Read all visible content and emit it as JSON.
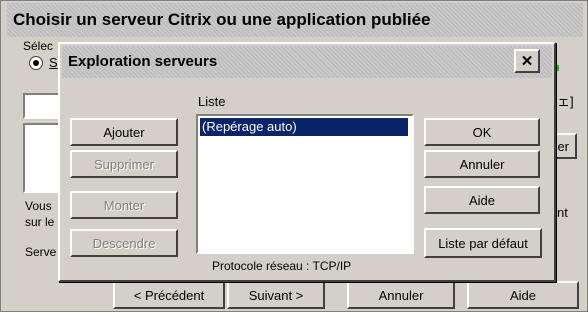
{
  "back_window": {
    "title": "Choisir un serveur Citrix ou une application publiée",
    "fragments": {
      "select_label": "Sélec",
      "radio_label": "S",
      "right_text_1": "ェ]",
      "right_text_2": "er",
      "you_text": "Vous",
      "on_text": "sur le",
      "right_text_3": "nt",
      "server_text": "Serve"
    },
    "buttons": {
      "previous": "< Précédent",
      "next": "Suivant >",
      "cancel": "Annuler",
      "help": "Aide"
    }
  },
  "dialog": {
    "title": "Exploration serveurs",
    "close_glyph": "✕",
    "list_label": "Liste",
    "list_items": [
      "(Repérage auto)"
    ],
    "protocol": "Protocole réseau : TCP/IP",
    "left_buttons": {
      "add": "Ajouter",
      "remove": "Supprimer",
      "up": "Monter",
      "down": "Descendre"
    },
    "right_buttons": {
      "ok": "OK",
      "cancel": "Annuler",
      "help": "Aide",
      "default_list": "Liste par défaut"
    }
  },
  "colors": {
    "face": "#d4d0c8",
    "selection": "#0a246a",
    "green_indicator": "#00c000"
  }
}
